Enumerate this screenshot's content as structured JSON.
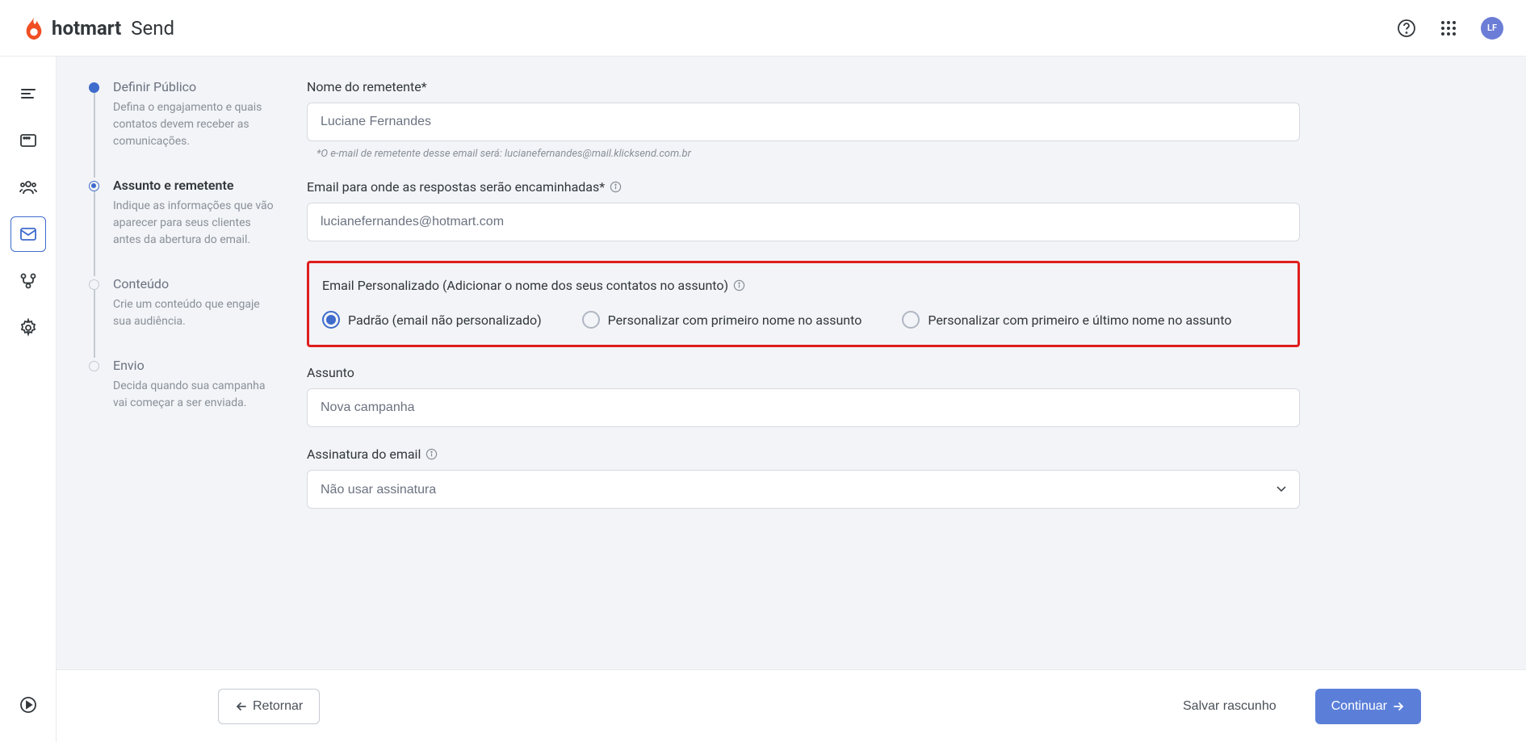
{
  "header": {
    "brand": "hotmart",
    "sub_brand": "Send",
    "avatar": "LF"
  },
  "steps": {
    "items": [
      {
        "title": "Definir Público",
        "desc": "Defina o engajamento e quais contatos devem receber as comunicações."
      },
      {
        "title": "Assunto e remetente",
        "desc": "Indique as informações que vão aparecer para seus clientes antes da abertura do email."
      },
      {
        "title": "Conteúdo",
        "desc": "Crie um conteúdo que engaje sua audiência."
      },
      {
        "title": "Envio",
        "desc": "Decida quando sua campanha vai começar a ser enviada."
      }
    ]
  },
  "form": {
    "sender_name_label": "Nome do remetente*",
    "sender_name_value": "Luciane Fernandes",
    "sender_email_note": "*O e-mail de remetente desse email será: lucianefernandes@mail.klicksend.com.br",
    "reply_email_label": "Email para onde as respostas serão encaminhadas*",
    "reply_email_value": "lucianefernandes@hotmart.com",
    "personalized_label": "Email Personalizado (Adicionar o nome dos seus contatos no assunto)",
    "radios": [
      "Padrão (email não personalizado)",
      "Personalizar com primeiro nome no assunto",
      "Personalizar com primeiro e último nome no assunto"
    ],
    "subject_label": "Assunto",
    "subject_value": "Nova campanha",
    "signature_label": "Assinatura do email",
    "signature_value": "Não usar assinatura"
  },
  "footer": {
    "back_label": "Retornar",
    "save_label": "Salvar rascunho",
    "continue_label": "Continuar"
  }
}
